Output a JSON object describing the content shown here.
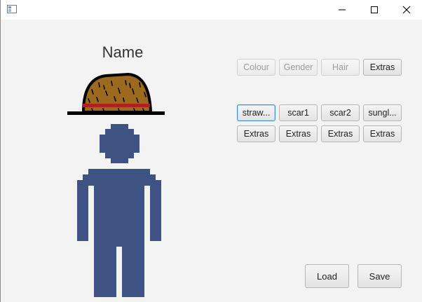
{
  "window": {
    "title": "",
    "controls": [
      "minimize-icon",
      "maximize-icon",
      "close-icon"
    ]
  },
  "character": {
    "name": "Name",
    "hat": "straw-hat-icon",
    "body_color": "#3f5383"
  },
  "categories": {
    "colour": "Colour",
    "gender": "Gender",
    "hair": "Hair",
    "extras": "Extras"
  },
  "items": [
    {
      "label": "straw...",
      "action": "Extras"
    },
    {
      "label": "scar1",
      "action": "Extras"
    },
    {
      "label": "scar2",
      "action": "Extras"
    },
    {
      "label": "sungl...",
      "action": "Extras"
    }
  ],
  "footer": {
    "load": "Load",
    "save": "Save"
  },
  "colors": {
    "focus": "#3c8fd8",
    "hat_brown": "#9b6a1f",
    "hat_band": "#b0201e"
  }
}
